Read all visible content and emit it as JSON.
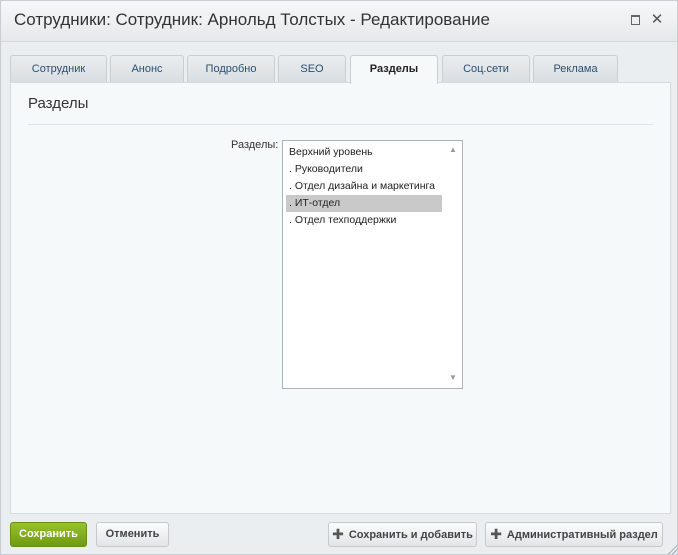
{
  "dialog": {
    "title": "Сотрудники: Сотрудник: Арнольд Толстых - Редактирование"
  },
  "tabs": [
    {
      "label": "Сотрудник",
      "active": false
    },
    {
      "label": "Анонс",
      "active": false
    },
    {
      "label": "Подробно",
      "active": false
    },
    {
      "label": "SEO",
      "active": false
    },
    {
      "label": "Разделы",
      "active": true
    },
    {
      "label": "Соц.сети",
      "active": false
    },
    {
      "label": "Реклама",
      "active": false
    }
  ],
  "panel": {
    "title": "Разделы",
    "field_label": "Разделы:",
    "options": [
      {
        "label": "Верхний уровень",
        "selected": false
      },
      {
        "label": ". Руководители",
        "selected": false
      },
      {
        "label": ". Отдел дизайна и маркетинга",
        "selected": false
      },
      {
        "label": ". ИТ-отдел",
        "selected": true
      },
      {
        "label": ". Отдел техподдержки",
        "selected": false
      }
    ]
  },
  "footer": {
    "save_label": "Сохранить",
    "cancel_label": "Отменить",
    "save_add_label": "Сохранить и добавить",
    "admin_label": "Административный раздел"
  },
  "colors": {
    "save_button": "#7aa61a",
    "selected_option": "#c9c9c9"
  }
}
